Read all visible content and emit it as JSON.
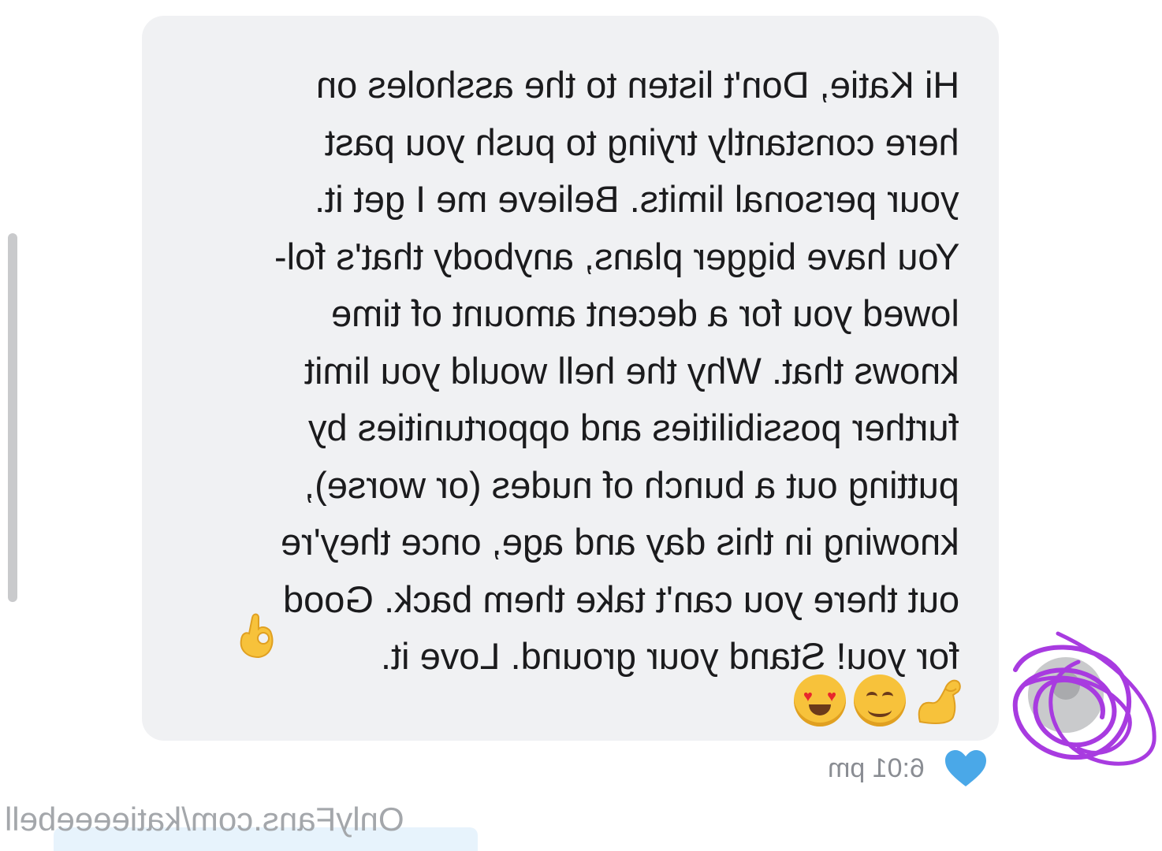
{
  "message": {
    "lines": [
      "Hi Katie, Don't listen to the assholes on",
      "here constantly trying to push you past",
      "your personal limits. Believe me I get it.",
      "You have bigger plans, anybody that's fol-",
      "lowed you for a decent amount of time",
      "knows that. Why the hell would you limit",
      "further possibilities and opportunities by",
      "putting out a bunch of nudes (or worse),",
      "knowing in this day and age, once they're",
      "out there you can't take them back. Good",
      "for you! Stand your ground. Love it."
    ],
    "emoji_inline": "ok-hand-emoji",
    "emoji_trailing": [
      "flexed-biceps-emoji",
      "smiling-face-emoji",
      "heart-eyes-emoji"
    ],
    "timestamp": "6:01 pm",
    "liked": true
  },
  "watermark": "OnlyFans.com/katieeeebell",
  "colors": {
    "bubble": "#f0f1f3",
    "text": "#1b1b1d",
    "timestamp": "#8a8d93",
    "like_heart": "#4aa8e8",
    "scribble": "#a83be0",
    "watermark": "#a4a7ab"
  },
  "mirrored": true
}
